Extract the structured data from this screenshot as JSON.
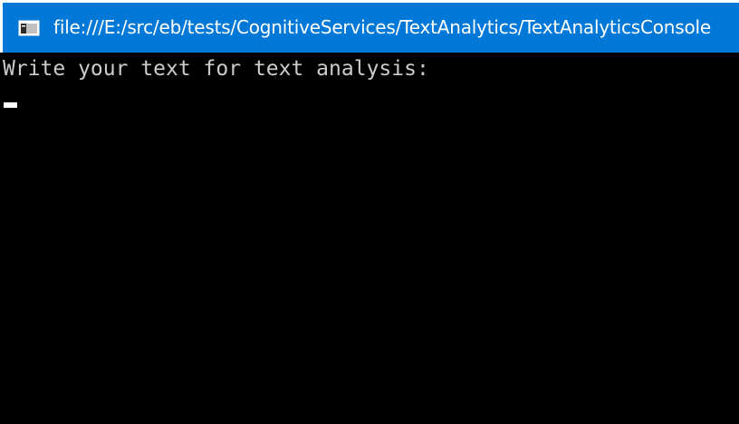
{
  "window": {
    "title": "file:///E:/src/eb/tests/CognitiveServices/TextAnalytics/TextAnalyticsConsole",
    "icon": "console-window-icon"
  },
  "console": {
    "prompt": "Write your text for text analysis:"
  },
  "colors": {
    "titlebar": "#0078d7",
    "console_background": "#000000",
    "console_text": "#cccccc",
    "cursor": "#ffffff"
  }
}
